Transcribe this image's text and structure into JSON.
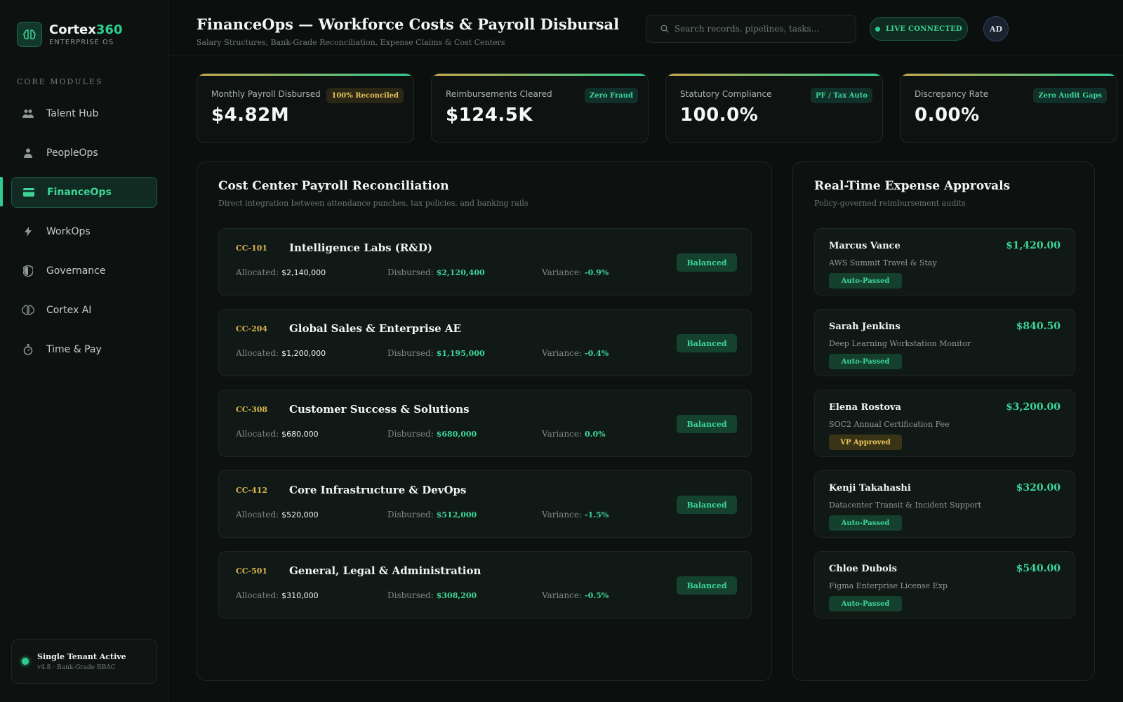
{
  "brand": {
    "name_main": "Cortex",
    "name_accent": "360",
    "subtitle": "ENTERPRISE OS"
  },
  "sidebar": {
    "section_label": "CORE MODULES",
    "items": [
      {
        "label": "Talent Hub",
        "icon": "people-icon"
      },
      {
        "label": "PeopleOps",
        "icon": "person-icon"
      },
      {
        "label": "FinanceOps",
        "icon": "card-icon",
        "active": true
      },
      {
        "label": "WorkOps",
        "icon": "bolt-icon"
      },
      {
        "label": "Governance",
        "icon": "shield-icon"
      },
      {
        "label": "Cortex AI",
        "icon": "brain-icon"
      },
      {
        "label": "Time & Pay",
        "icon": "stopwatch-icon"
      }
    ],
    "tenant": {
      "title": "Single Tenant Active",
      "subtitle": "v4.8 · Bank-Grade RBAC"
    }
  },
  "header": {
    "title": "FinanceOps — Workforce Costs & Payroll Disbursal",
    "subtitle": "Salary Structures, Bank-Grade Reconciliation, Expense Claims & Cost Centers",
    "search_placeholder": "Search records, pipelines, tasks...",
    "status": "LIVE CONNECTED",
    "avatar": "AD"
  },
  "kpis": [
    {
      "label": "Monthly Payroll Disbursed",
      "value": "$4.82M",
      "badge": "100% Reconciled",
      "badge_tone": "gold"
    },
    {
      "label": "Reimbursements Cleared",
      "value": "$124.5K",
      "badge": "Zero Fraud",
      "badge_tone": "green"
    },
    {
      "label": "Statutory Compliance",
      "value": "100.0%",
      "badge": "PF / Tax Auto",
      "badge_tone": "green"
    },
    {
      "label": "Discrepancy Rate",
      "value": "0.00%",
      "badge": "Zero Audit Gaps",
      "badge_tone": "green"
    }
  ],
  "reconciliation": {
    "title": "Cost Center Payroll Reconciliation",
    "subtitle": "Direct integration between attendance punches, tax policies, and banking rails",
    "labels": {
      "allocated": "Allocated:",
      "disbursed": "Disbursed:",
      "variance": "Variance:"
    },
    "rows": [
      {
        "code": "CC-101",
        "name": "Intelligence Labs (R&D)",
        "allocated": "$2,140,000",
        "disbursed": "$2,120,400",
        "variance": "-0.9%",
        "status": "Balanced"
      },
      {
        "code": "CC-204",
        "name": "Global Sales & Enterprise AE",
        "allocated": "$1,200,000",
        "disbursed": "$1,195,000",
        "variance": "-0.4%",
        "status": "Balanced"
      },
      {
        "code": "CC-308",
        "name": "Customer Success & Solutions",
        "allocated": "$680,000",
        "disbursed": "$680,000",
        "variance": "0.0%",
        "status": "Balanced"
      },
      {
        "code": "CC-412",
        "name": "Core Infrastructure & DevOps",
        "allocated": "$520,000",
        "disbursed": "$512,000",
        "variance": "-1.5%",
        "status": "Balanced"
      },
      {
        "code": "CC-501",
        "name": "General, Legal & Administration",
        "allocated": "$310,000",
        "disbursed": "$308,200",
        "variance": "-0.5%",
        "status": "Balanced"
      }
    ]
  },
  "expenses": {
    "title": "Real-Time Expense Approvals",
    "subtitle": "Policy-governed reimbursement audits",
    "rows": [
      {
        "name": "Marcus Vance",
        "amount": "$1,420.00",
        "desc": "AWS Summit Travel & Stay",
        "status": "Auto-Passed",
        "tone": "auto"
      },
      {
        "name": "Sarah Jenkins",
        "amount": "$840.50",
        "desc": "Deep Learning Workstation Monitor",
        "status": "Auto-Passed",
        "tone": "auto"
      },
      {
        "name": "Elena Rostova",
        "amount": "$3,200.00",
        "desc": "SOC2 Annual Certification Fee",
        "status": "VP Approved",
        "tone": "vp"
      },
      {
        "name": "Kenji Takahashi",
        "amount": "$320.00",
        "desc": "Datacenter Transit & Incident Support",
        "status": "Auto-Passed",
        "tone": "auto"
      },
      {
        "name": "Chloe Dubois",
        "amount": "$540.00",
        "desc": "Figma Enterprise License Exp",
        "status": "Auto-Passed",
        "tone": "auto"
      }
    ]
  },
  "colors": {
    "accent": "#2ecc8f",
    "gold": "#d9b54c",
    "background": "#0b0f0e"
  }
}
